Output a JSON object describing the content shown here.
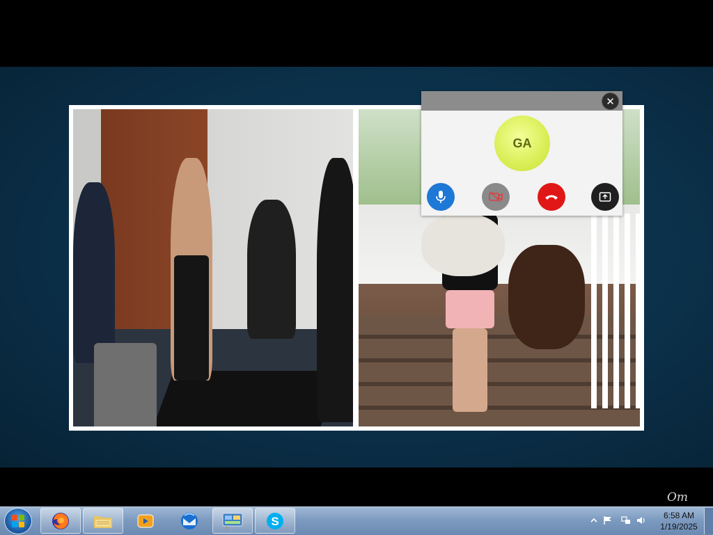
{
  "call": {
    "avatar_initials": "GA",
    "accent_colors": {
      "mic": "#1e78d6",
      "video": "#8a8a8a",
      "hangup": "#e01717",
      "share": "#1f1f1f",
      "avatar": "#d9ee55"
    },
    "controls": [
      {
        "name": "mic-button",
        "icon": "microphone-icon",
        "state": "on"
      },
      {
        "name": "video-button",
        "icon": "video-off-icon",
        "state": "off"
      },
      {
        "name": "hangup-button",
        "icon": "phone-hangup-icon"
      },
      {
        "name": "share-screen-button",
        "icon": "share-screen-icon"
      }
    ],
    "close_icon": "close-icon"
  },
  "shared_screen": {
    "content": "photo collage"
  },
  "taskbar": {
    "pinned": [
      {
        "name": "firefox",
        "icon": "firefox-icon"
      },
      {
        "name": "file-explorer",
        "icon": "folder-icon"
      },
      {
        "name": "media-player",
        "icon": "media-player-icon"
      },
      {
        "name": "thunderbird",
        "icon": "thunderbird-icon"
      },
      {
        "name": "control-panel",
        "icon": "control-panel-icon"
      },
      {
        "name": "skype",
        "icon": "skype-icon"
      }
    ],
    "tray_icons": [
      "show-hidden-icons-chevron",
      "action-center-flag-icon",
      "network-icon",
      "volume-icon"
    ],
    "clock": {
      "time": "6:58 AM",
      "date": "1/19/2025"
    }
  }
}
